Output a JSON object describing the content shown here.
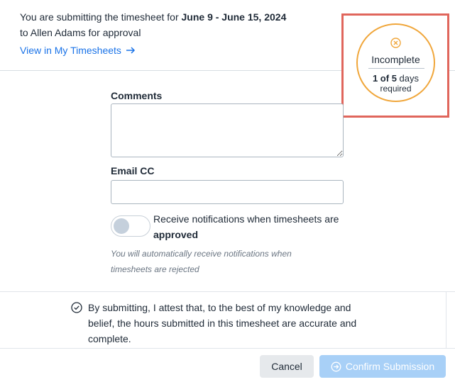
{
  "header": {
    "intro_prefix": "You are submitting the timesheet for ",
    "date_range": "June 9 - June 15, 2024",
    "intro_line2": "to Allen Adams for approval",
    "view_link": "View in My Timesheets"
  },
  "status": {
    "icon": "x-circle-icon",
    "title": "Incomplete",
    "days_done": "1 of 5",
    "days_suffix": " days",
    "required": "required",
    "color": "#f0a63a",
    "highlight_color": "#e0665c"
  },
  "form": {
    "comments_label": "Comments",
    "comments_value": "",
    "email_label": "Email CC",
    "email_value": "",
    "toggle_on": false,
    "toggle_text": "Receive notifications when timesheets are",
    "toggle_bold": "approved",
    "hint_line1": "You will automatically receive notifications when",
    "hint_line2": "timesheets are rejected"
  },
  "attestation": {
    "icon": "check-circle-icon",
    "line1": "By submitting, I attest that, to the best of my knowledge and",
    "line2": "belief, the hours submitted in this timesheet are accurate and",
    "line3": "complete."
  },
  "actions": {
    "cancel": "Cancel",
    "confirm": "Confirm Submission",
    "confirm_icon": "arrow-circle-right-icon",
    "accent": "#1a73e8"
  }
}
